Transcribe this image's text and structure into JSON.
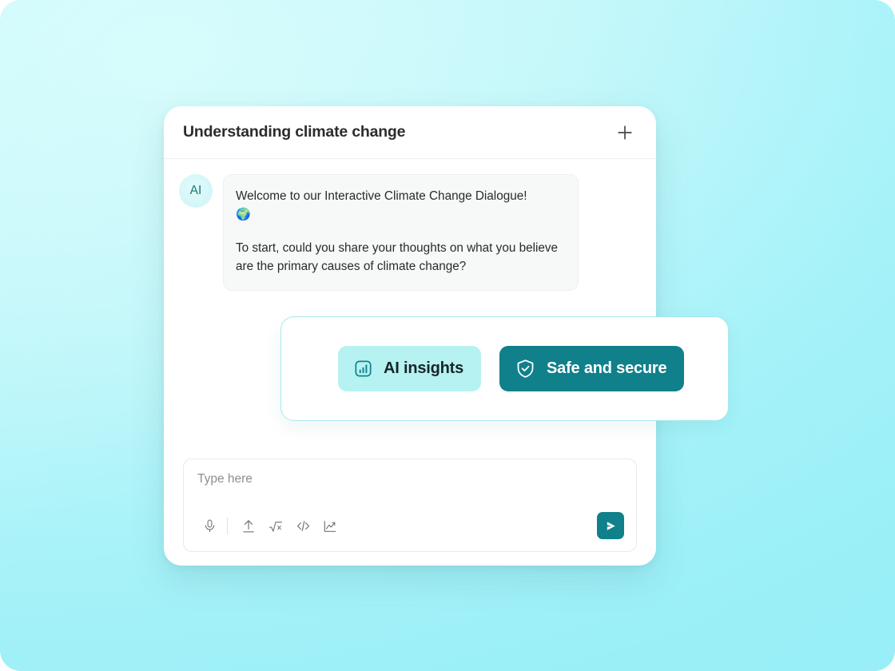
{
  "header": {
    "title": "Understanding climate change",
    "add_icon": "plus-icon"
  },
  "conversation": {
    "messages": [
      {
        "avatar_label": "AI",
        "paragraph_1": "Welcome to our Interactive Climate Change Dialogue!",
        "emoji": "🌍",
        "paragraph_2": "To start, could you share your thoughts on what you believe are the primary causes of climate change?"
      }
    ]
  },
  "badges": [
    {
      "label": "AI insights",
      "icon": "bar-chart-icon",
      "style": "light",
      "background": "#b6f2f2",
      "text_color": "#17252b"
    },
    {
      "label": "Safe and secure",
      "icon": "shield-check-icon",
      "style": "dark",
      "background": "#10808b",
      "text_color": "#ffffff"
    }
  ],
  "composer": {
    "placeholder": "Type here",
    "value": "",
    "tools": [
      {
        "name": "microphone-icon",
        "label": "Voice input"
      },
      {
        "name": "upload-icon",
        "label": "Upload file"
      },
      {
        "name": "math-icon",
        "label": "Insert math"
      },
      {
        "name": "code-icon",
        "label": "Insert code"
      },
      {
        "name": "chart-icon",
        "label": "Insert chart"
      }
    ],
    "send_icon": "send-icon"
  },
  "theme": {
    "accent": "#10808b",
    "accent_light": "#b6f2f2",
    "background_start": "#d4fbfb",
    "background_end": "#9deff7",
    "panel_background": "#ffffff",
    "bubble_background": "#f7f8f8"
  }
}
